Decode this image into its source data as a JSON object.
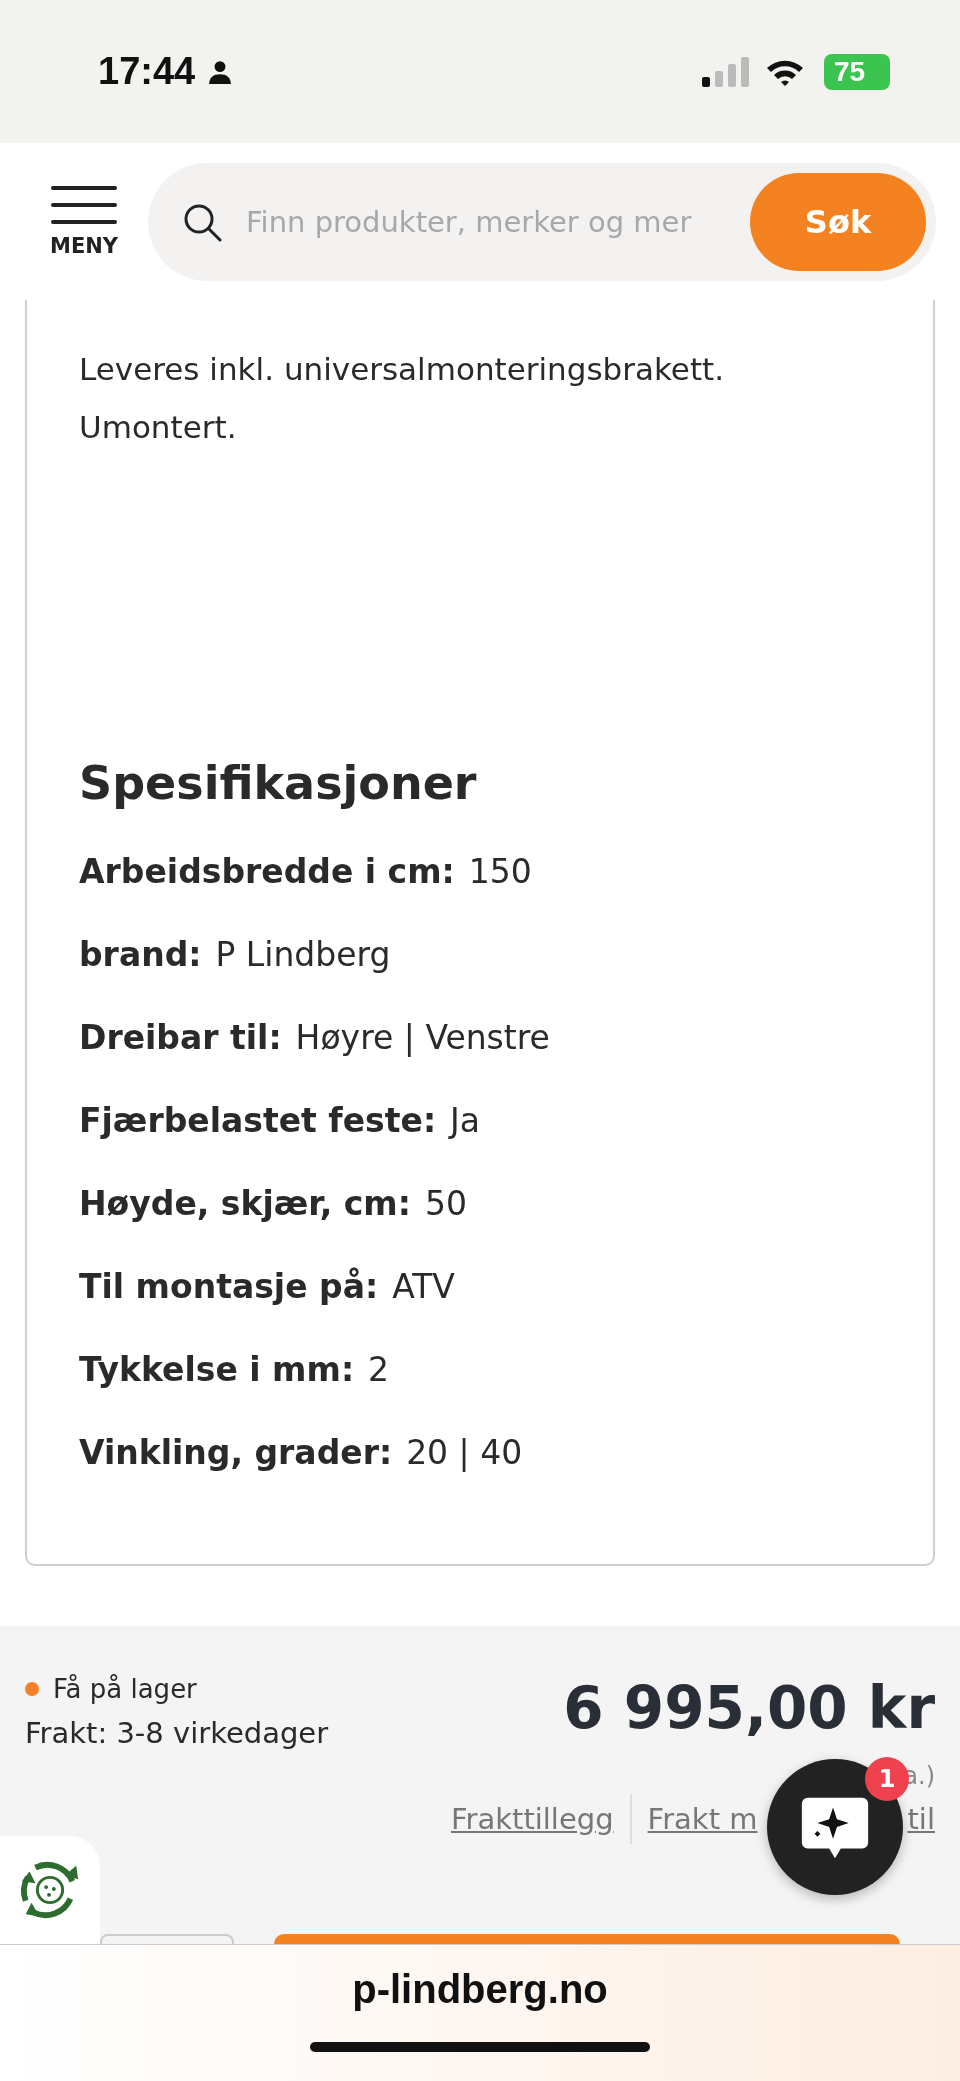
{
  "status_bar": {
    "time": "17:44",
    "battery": "75"
  },
  "header": {
    "menu_label": "MENY",
    "search": {
      "placeholder": "Finn produkter, merker og mer"
    },
    "search_button": "Søk"
  },
  "description": "Leveres inkl. universalmonteringsbrakett. Umontert.",
  "specs": {
    "title": "Spesifikasjoner",
    "rows": [
      {
        "label": "Arbeidsbredde i cm:",
        "value": "150"
      },
      {
        "label": "brand:",
        "value": "P Lindberg"
      },
      {
        "label": "Dreibar til:",
        "value": "Høyre | Venstre"
      },
      {
        "label": "Fjærbelastet feste:",
        "value": "Ja"
      },
      {
        "label": "Høyde, skjær, cm:",
        "value": "50"
      },
      {
        "label": "Til montasje på:",
        "value": "ATV"
      },
      {
        "label": "Tykkelse i mm:",
        "value": "2"
      },
      {
        "label": "Vinkling, grader:",
        "value": "20 | 40"
      }
    ]
  },
  "purchase": {
    "stock": {
      "label": "Få på lager",
      "color": "#f5822a"
    },
    "shipping": "Frakt: 3-8 virkedager",
    "price": "6 995,00 kr",
    "price_note": "a.)",
    "links": [
      "Frakttillegg",
      "Frakt m",
      "til"
    ]
  },
  "chat": {
    "badge": "1"
  },
  "browser": {
    "url": "p-lindberg.no"
  }
}
